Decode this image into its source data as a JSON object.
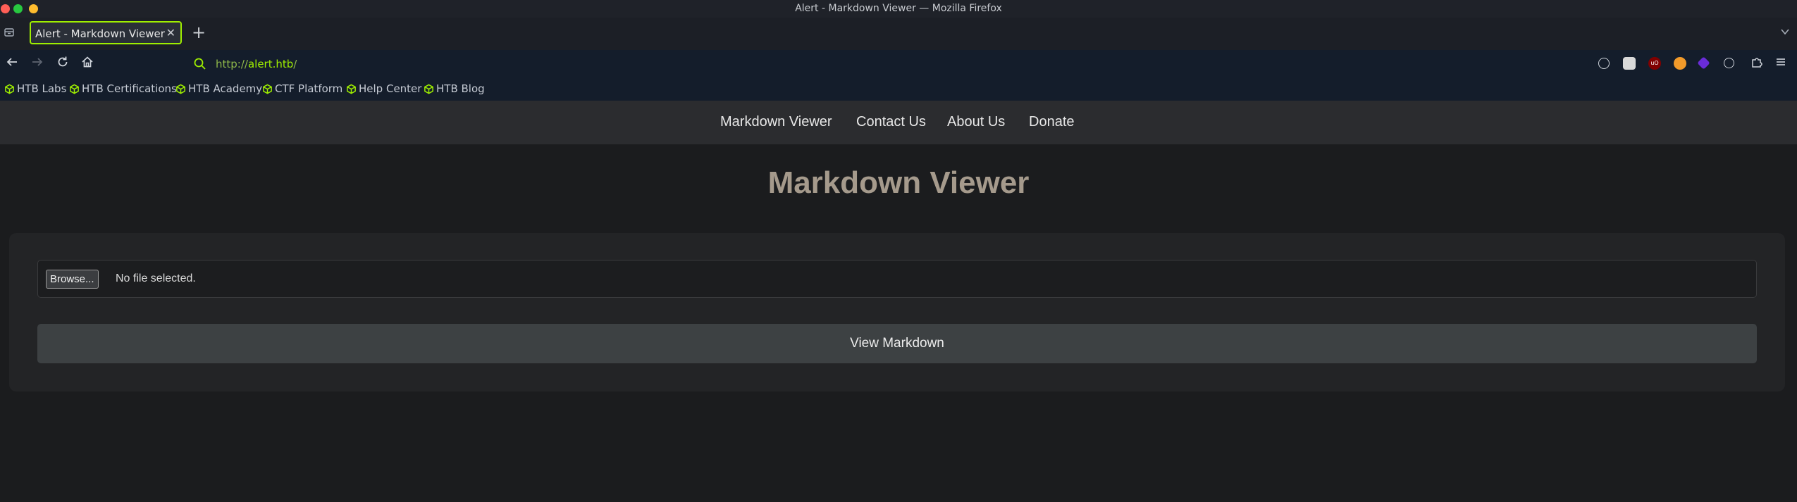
{
  "window": {
    "title": "Alert - Markdown Viewer — Mozilla Firefox"
  },
  "tab": {
    "title": "Alert - Markdown Viewer"
  },
  "address_bar": {
    "protocol": "http://",
    "host": "alert.htb",
    "path": "/"
  },
  "bookmarks": [
    {
      "label": "HTB Labs"
    },
    {
      "label": "HTB Certifications"
    },
    {
      "label": "HTB Academy"
    },
    {
      "label": "CTF Platform"
    },
    {
      "label": "Help Center"
    },
    {
      "label": "HTB Blog"
    }
  ],
  "site_nav": {
    "items": [
      {
        "label": "Markdown Viewer"
      },
      {
        "label": "Contact Us"
      },
      {
        "label": "About Us"
      },
      {
        "label": "Donate"
      }
    ]
  },
  "main": {
    "title": "Markdown Viewer",
    "file_input": {
      "button_label": "Browse...",
      "status": "No file selected."
    },
    "submit_label": "View Markdown"
  },
  "colors": {
    "accent": "#9fef00",
    "page_bg": "#1b1c1e",
    "nav_bg": "#2b2c2f",
    "title": "#a59a8c",
    "browser_chrome": "#141d2b"
  },
  "icons": {
    "nav": [
      "back-arrow-icon",
      "forward-arrow-icon",
      "reload-icon",
      "home-icon"
    ],
    "extensions": [
      "account-icon",
      "shield-icon",
      "ublock-icon",
      "fox-icon",
      "purple-gem-icon",
      "settings-icon",
      "extensions-icon",
      "menu-icon"
    ]
  }
}
